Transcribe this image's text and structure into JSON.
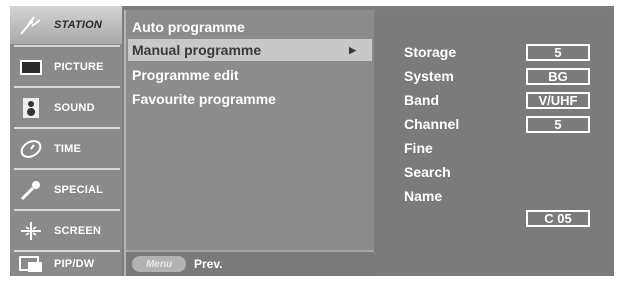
{
  "sidebar": {
    "items": [
      {
        "label": "STATION",
        "icon": "antenna-icon"
      },
      {
        "label": "PICTURE",
        "icon": "monitor-icon"
      },
      {
        "label": "SOUND",
        "icon": "speaker-icon"
      },
      {
        "label": "TIME",
        "icon": "clock-icon"
      },
      {
        "label": "SPECIAL",
        "icon": "key-icon"
      },
      {
        "label": "SCREEN",
        "icon": "crosshair-icon"
      },
      {
        "label": "PIP/DW",
        "icon": "pip-icon"
      }
    ]
  },
  "menu": {
    "items": [
      {
        "label": "Auto programme"
      },
      {
        "label": "Manual programme",
        "arrow": "▶"
      },
      {
        "label": "Programme edit"
      },
      {
        "label": "Favourite programme"
      }
    ],
    "footer": {
      "chip": "Menu",
      "prev": "Prev."
    }
  },
  "panel": {
    "rows": [
      {
        "label": "Storage",
        "value": "5"
      },
      {
        "label": "System",
        "value": "BG"
      },
      {
        "label": "Band",
        "value": "V/UHF"
      },
      {
        "label": "Channel",
        "value": "5"
      },
      {
        "label": "Fine"
      },
      {
        "label": "Search"
      },
      {
        "label": "Name",
        "value": "C 05"
      }
    ]
  },
  "colors": {
    "screen_bg": "#7d7d7d",
    "highlight": "#c8c8c8",
    "text": "#ffffff"
  }
}
